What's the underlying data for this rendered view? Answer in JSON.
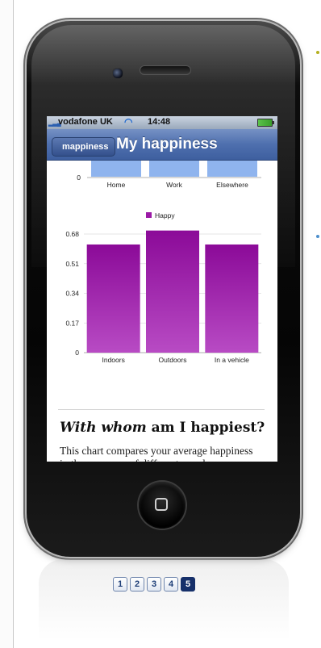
{
  "status_bar": {
    "carrier": "vodafone UK",
    "time": "14:48"
  },
  "nav": {
    "back_label": "mappiness",
    "title": "My happiness"
  },
  "charts": [
    {
      "type": "bar",
      "partial": true,
      "categories": [
        "Home",
        "Work",
        "Elsewhere"
      ],
      "y_visible_tick": "0",
      "bar_color": "#8fb4ee"
    },
    {
      "type": "bar",
      "legend": "Happy",
      "categories": [
        "Indoors",
        "Outdoors",
        "In a vehicle"
      ],
      "values": [
        0.62,
        0.7,
        0.62
      ],
      "ylim": [
        0,
        0.68
      ],
      "y_ticks": [
        "0.68",
        "0.51",
        "0.34",
        "0.17",
        "0"
      ],
      "bar_color": "#9b1aa6"
    }
  ],
  "section": {
    "heading_italic": "With whom",
    "heading_rest": " am I happiest?",
    "body": "This chart compares your average happiness in the company of different people."
  },
  "pagination": {
    "pages": [
      "1",
      "2",
      "3",
      "4",
      "5"
    ],
    "active": "5"
  }
}
